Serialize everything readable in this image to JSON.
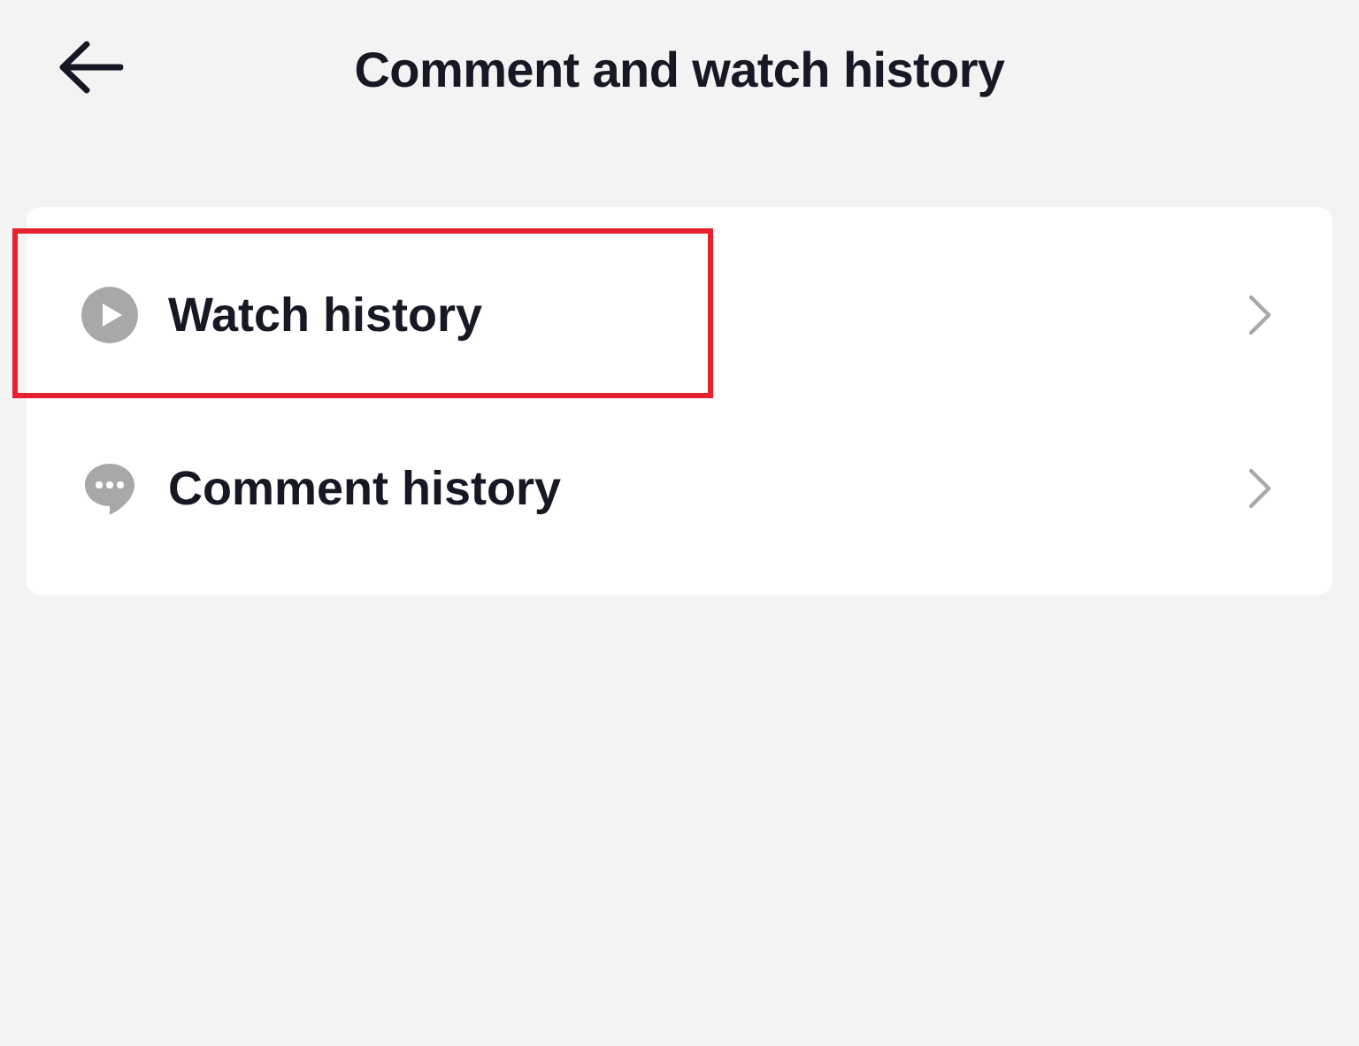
{
  "header": {
    "title": "Comment and watch history"
  },
  "items": [
    {
      "kind": "play",
      "label": "Watch history",
      "highlighted": true
    },
    {
      "kind": "comment",
      "label": "Comment history",
      "highlighted": false
    }
  ]
}
